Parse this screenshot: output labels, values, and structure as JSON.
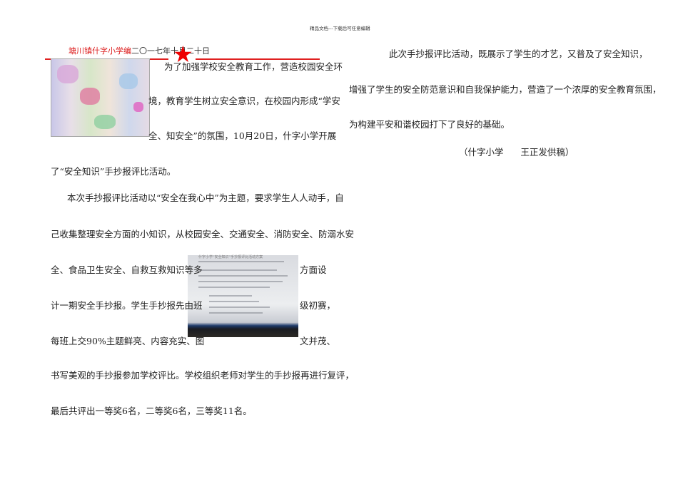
{
  "header_note": "精品文档---下载后可任意编辑",
  "masthead": {
    "school": "塘川镇什字小学编",
    "date": "二〇一七年十月二十日"
  },
  "left_lines": [
    "为了加强学校安全教育工作，营造校园安全环",
    "境，教育学生树立安全意识，在校园内形成“学安",
    "全、知安全”的氛围，10月20日，什字小学开展",
    "了“安全知识”手抄报评比活动。",
    "本次手抄报评比活动以“安全在我心中”为主题，要求学生人人动手，自",
    "己收集整理安全方面的小知识，从校园安全、交通安全、消防安全、防溺水安",
    "全、食品卫生安全、自救互救知识等多",
    "方面设",
    "计一期安全手抄报。学生手抄报先由班",
    "级初赛，",
    "每班上交90%主题鲜亮、内容充实、图",
    "文并茂、",
    "书写美观的手抄报参加学校评比。学校组织老师对学生的手抄报再进行复评，",
    "最后共评出一等奖6名，二等奖6名，三等奖11名。"
  ],
  "right_lines": [
    "此次手抄报评比活动，既展示了学生的才艺，又普及了安全知识，",
    "增强了学生的安全防范意识和自我保护能力，营造了一个浓厚的安全教育氛围，",
    "为构建平安和谐校园打下了良好的基础。",
    "（什字小学      王正发供稿）"
  ],
  "photo2_caption": "什字小学“安全知识”手抄报评比活动方案"
}
